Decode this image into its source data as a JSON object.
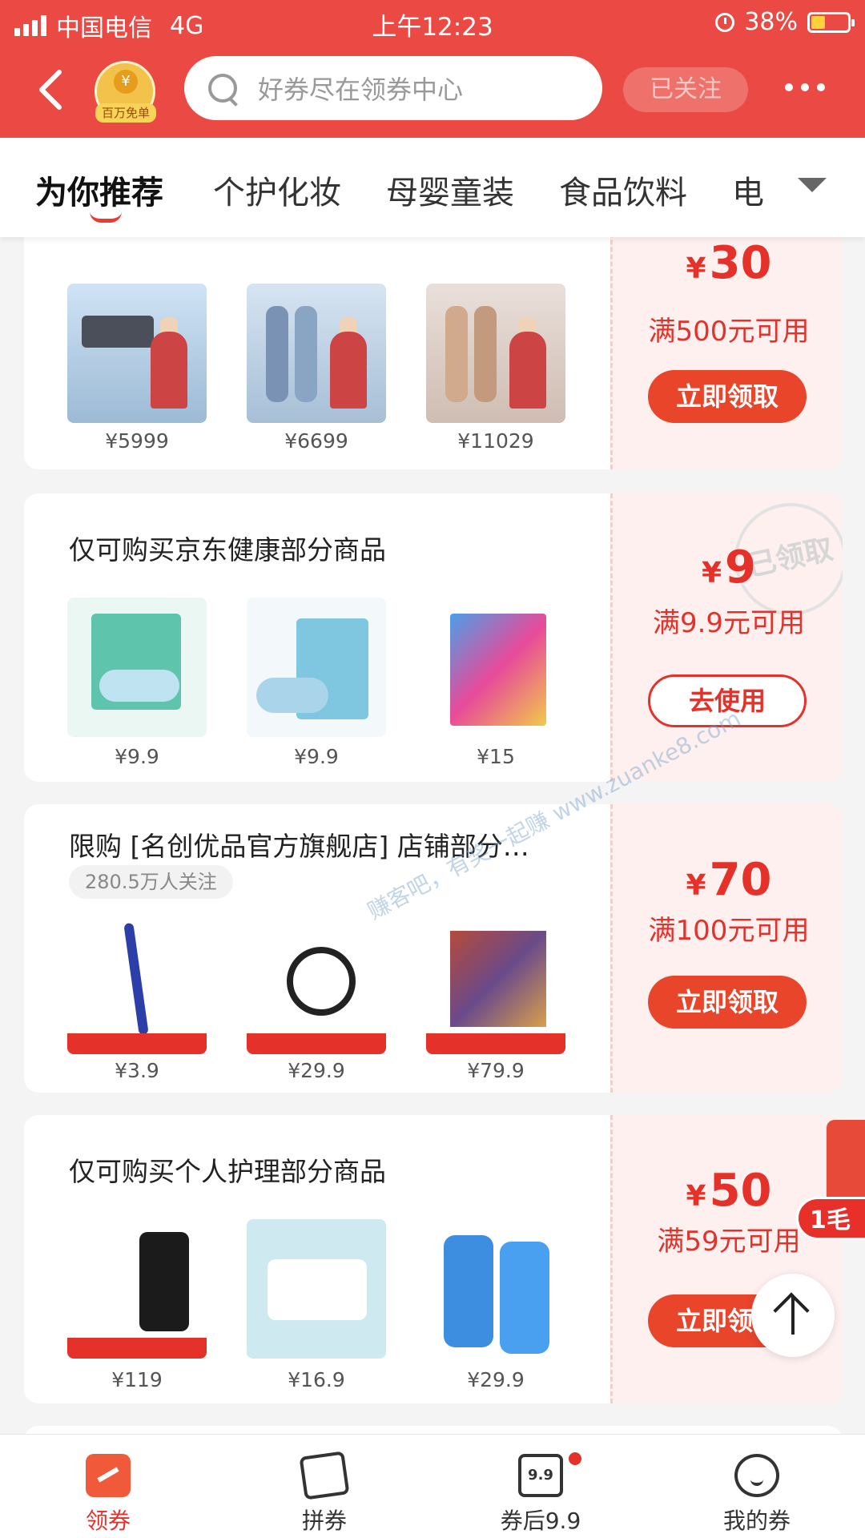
{
  "status_bar": {
    "carrier": "中国电信",
    "network": "4G",
    "time": "上午12:23",
    "battery": "38%",
    "battery_level": 0.38
  },
  "nav": {
    "badge_label": "百万免单",
    "badge_coin": "¥",
    "search_placeholder": "好券尽在领券中心",
    "follow_label": "已关注"
  },
  "tabs": [
    {
      "label": "为你推荐",
      "active": true
    },
    {
      "label": "个护化妆",
      "active": false
    },
    {
      "label": "母婴童装",
      "active": false
    },
    {
      "label": "食品饮料",
      "active": false
    },
    {
      "label": "电",
      "active": false
    }
  ],
  "cards": [
    {
      "title": "",
      "products": [
        {
          "price": "¥5999"
        },
        {
          "price": "¥6699"
        },
        {
          "price": "¥11029"
        }
      ],
      "amount": "30",
      "currency": "¥",
      "condition": "满500元可用",
      "button": "立即领取",
      "claimed": false
    },
    {
      "title": "仅可购买京东健康部分商品",
      "products": [
        {
          "price": "¥9.9"
        },
        {
          "price": "¥9.9"
        },
        {
          "price": "¥15"
        }
      ],
      "amount": "9",
      "currency": "¥",
      "condition": "满9.9元可用",
      "button": "去使用",
      "claimed": true,
      "stamp": "已领取"
    },
    {
      "title": "限购 [名创优品官方旗舰店] 店铺部分…",
      "followers": "280.5万人关注",
      "products": [
        {
          "price": "¥3.9"
        },
        {
          "price": "¥29.9"
        },
        {
          "price": "¥79.9"
        }
      ],
      "amount": "70",
      "currency": "¥",
      "condition": "满100元可用",
      "button": "立即领取",
      "claimed": false
    },
    {
      "title": "仅可购买个人护理部分商品",
      "products": [
        {
          "price": "¥119"
        },
        {
          "price": "¥16.9"
        },
        {
          "price": "¥29.9"
        }
      ],
      "amount": "50",
      "currency": "¥",
      "condition": "满59元可用",
      "button": "立即领取",
      "claimed": false
    }
  ],
  "side_tag": "1毛",
  "watermark": "赚客吧，有奖一起赚 www.zuanke8.com",
  "bottom_nav": [
    {
      "label": "领券",
      "active": true,
      "icon": "coupon-icon"
    },
    {
      "label": "拼券",
      "active": false,
      "icon": "group-coupon-icon"
    },
    {
      "label": "券后9.9",
      "active": false,
      "icon": "price-99-icon",
      "icon_text": "9.9"
    },
    {
      "label": "我的券",
      "active": false,
      "icon": "my-coupon-icon"
    }
  ],
  "colors": {
    "brand": "#ea4a43",
    "accent": "#e4322b"
  }
}
